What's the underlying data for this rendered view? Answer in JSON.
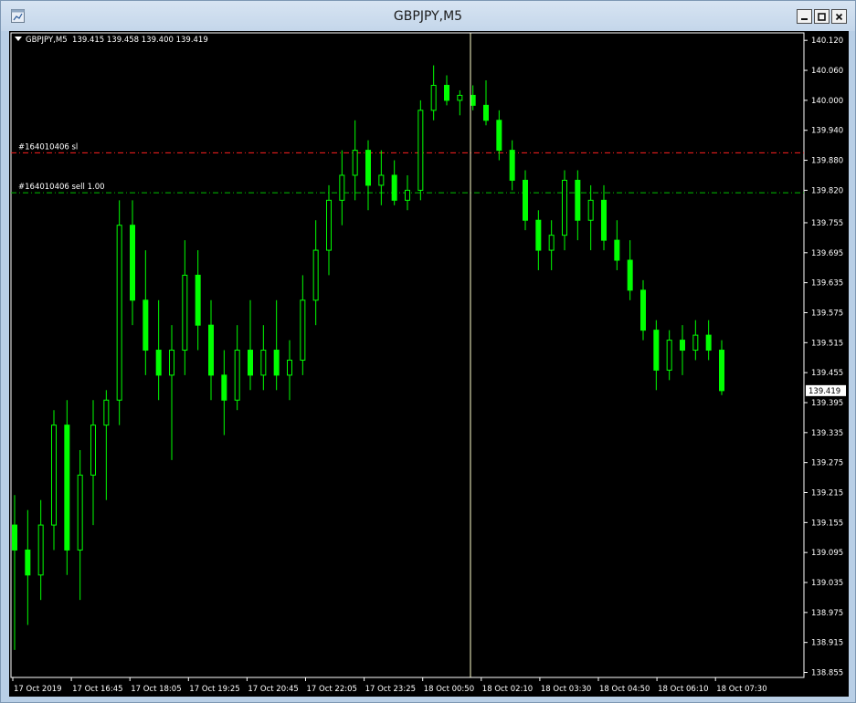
{
  "window": {
    "title": "GBPJPY,M5"
  },
  "chart_header": {
    "symbol_tf": "GBPJPY,M5",
    "ohlc": "139.415 139.458 139.400 139.419"
  },
  "colors": {
    "background": "#000000",
    "candle": "#00ff00",
    "foreground": "#ffffff",
    "sl_line": "#ff2020",
    "order_line": "#00c000",
    "cursor_line": "#ffffcc"
  },
  "trade_lines": [
    {
      "label": "#164010406 sl",
      "price": 139.895,
      "color": "#ff2020"
    },
    {
      "label": "#164010406 sell 1.00",
      "price": 139.815,
      "color": "#00c000"
    }
  ],
  "current_price": "139.419",
  "chart_data": {
    "type": "candlestick",
    "title": "GBPJPY,M5",
    "y_ticks": [
      "140.120",
      "140.060",
      "140.000",
      "139.940",
      "139.880",
      "139.820",
      "139.755",
      "139.695",
      "139.635",
      "139.575",
      "139.515",
      "139.455",
      "139.395",
      "139.335",
      "139.275",
      "139.215",
      "139.155",
      "139.095",
      "139.035",
      "138.975",
      "138.915",
      "138.855"
    ],
    "x_ticks": [
      "17 Oct 2019",
      "17 Oct 16:45",
      "17 Oct 18:05",
      "17 Oct 19:25",
      "17 Oct 20:45",
      "17 Oct 22:05",
      "17 Oct 23:25",
      "18 Oct 00:50",
      "18 Oct 02:10",
      "18 Oct 03:30",
      "18 Oct 04:50",
      "18 Oct 06:10",
      "18 Oct 07:30"
    ],
    "ylim": [
      138.845,
      140.135
    ],
    "grid": false,
    "series": [
      {
        "values": [
          [
            139.15,
            139.21,
            138.9,
            139.1
          ],
          [
            139.1,
            139.18,
            138.95,
            139.05
          ],
          [
            139.05,
            139.2,
            139.0,
            139.15
          ],
          [
            139.15,
            139.38,
            139.1,
            139.35
          ],
          [
            139.35,
            139.4,
            139.05,
            139.1
          ],
          [
            139.1,
            139.3,
            139.0,
            139.25
          ],
          [
            139.25,
            139.4,
            139.15,
            139.35
          ],
          [
            139.35,
            139.42,
            139.2,
            139.4
          ],
          [
            139.4,
            139.8,
            139.35,
            139.75
          ],
          [
            139.75,
            139.8,
            139.55,
            139.6
          ],
          [
            139.6,
            139.7,
            139.45,
            139.5
          ],
          [
            139.5,
            139.6,
            139.4,
            139.45
          ],
          [
            139.45,
            139.55,
            139.28,
            139.5
          ],
          [
            139.5,
            139.72,
            139.45,
            139.65
          ],
          [
            139.65,
            139.7,
            139.5,
            139.55
          ],
          [
            139.55,
            139.6,
            139.4,
            139.45
          ],
          [
            139.45,
            139.5,
            139.33,
            139.4
          ],
          [
            139.4,
            139.55,
            139.38,
            139.5
          ],
          [
            139.5,
            139.6,
            139.42,
            139.45
          ],
          [
            139.45,
            139.55,
            139.42,
            139.5
          ],
          [
            139.5,
            139.6,
            139.42,
            139.45
          ],
          [
            139.45,
            139.52,
            139.4,
            139.48
          ],
          [
            139.48,
            139.65,
            139.45,
            139.6
          ],
          [
            139.6,
            139.76,
            139.55,
            139.7
          ],
          [
            139.7,
            139.83,
            139.65,
            139.8
          ],
          [
            139.8,
            139.9,
            139.75,
            139.85
          ],
          [
            139.85,
            139.96,
            139.8,
            139.9
          ],
          [
            139.9,
            139.92,
            139.78,
            139.83
          ],
          [
            139.83,
            139.9,
            139.79,
            139.85
          ],
          [
            139.85,
            139.88,
            139.79,
            139.8
          ],
          [
            139.8,
            139.85,
            139.78,
            139.82
          ],
          [
            139.82,
            140.0,
            139.8,
            139.98
          ],
          [
            139.98,
            140.07,
            139.96,
            140.03
          ],
          [
            140.03,
            140.05,
            139.99,
            140.0
          ],
          [
            140.0,
            140.02,
            139.97,
            140.01
          ],
          [
            140.01,
            140.03,
            139.98,
            139.99
          ],
          [
            139.99,
            140.04,
            139.95,
            139.96
          ],
          [
            139.96,
            139.98,
            139.88,
            139.9
          ],
          [
            139.9,
            139.92,
            139.82,
            139.84
          ],
          [
            139.84,
            139.86,
            139.74,
            139.76
          ],
          [
            139.76,
            139.78,
            139.66,
            139.7
          ],
          [
            139.7,
            139.76,
            139.66,
            139.73
          ],
          [
            139.73,
            139.86,
            139.7,
            139.84
          ],
          [
            139.84,
            139.86,
            139.72,
            139.76
          ],
          [
            139.76,
            139.83,
            139.7,
            139.8
          ],
          [
            139.8,
            139.83,
            139.7,
            139.72
          ],
          [
            139.72,
            139.76,
            139.66,
            139.68
          ],
          [
            139.68,
            139.72,
            139.6,
            139.62
          ],
          [
            139.62,
            139.64,
            139.52,
            139.54
          ],
          [
            139.54,
            139.56,
            139.42,
            139.46
          ],
          [
            139.46,
            139.54,
            139.44,
            139.52
          ],
          [
            139.52,
            139.55,
            139.45,
            139.5
          ],
          [
            139.5,
            139.56,
            139.48,
            139.53
          ],
          [
            139.53,
            139.56,
            139.48,
            139.5
          ],
          [
            139.5,
            139.52,
            139.41,
            139.419
          ]
        ]
      }
    ]
  }
}
